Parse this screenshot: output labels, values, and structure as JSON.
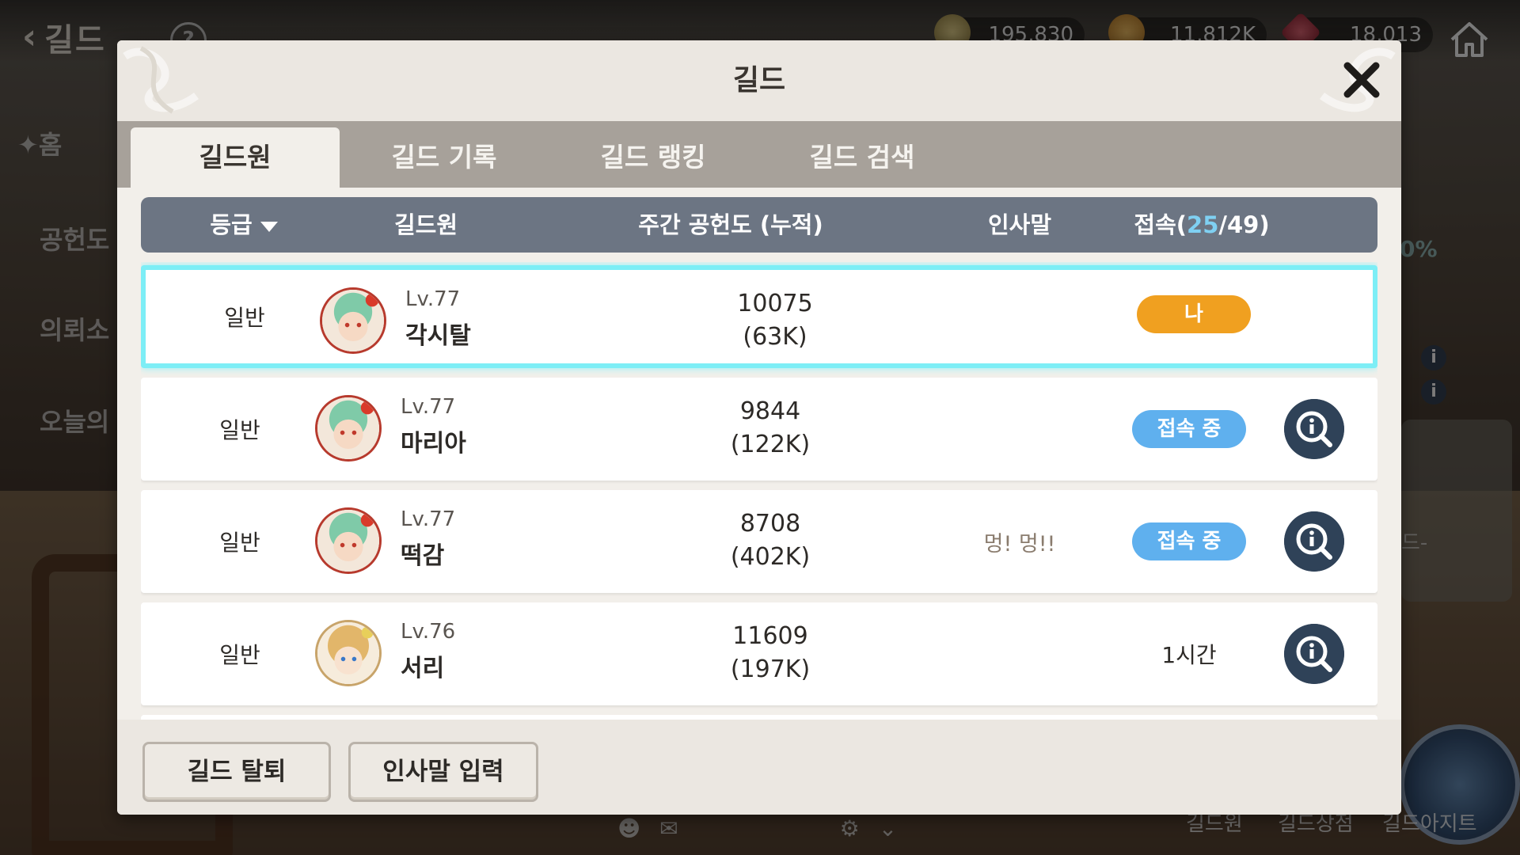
{
  "hud": {
    "back_title": "길드",
    "currencies": [
      {
        "value": "195,830",
        "icon": "gem-icon"
      },
      {
        "value": "11,812K",
        "icon": "gold-coin-icon"
      },
      {
        "value": "18,013",
        "icon": "crystal-icon"
      }
    ],
    "side_menu": [
      "홈",
      "공헌도",
      "의뢰소",
      "오늘의"
    ],
    "bottom_nav": [
      "길드원",
      "길드상점",
      "길드아지트"
    ],
    "side_percent": "0%",
    "side_label": "드-"
  },
  "modal": {
    "title": "길드",
    "tabs": [
      {
        "label": "길드원",
        "active": true
      },
      {
        "label": "길드 기록",
        "active": false
      },
      {
        "label": "길드 랭킹",
        "active": false
      },
      {
        "label": "길드 검색",
        "active": false
      }
    ],
    "columns": {
      "grade": "등급",
      "member": "길드원",
      "weekly_contribution": "주간 공헌도 (누적)",
      "greeting": "인사말",
      "online_label": "접속",
      "online_count": "25",
      "online_total": "/49"
    },
    "members": [
      {
        "grade": "일반",
        "level": "Lv.77",
        "name": "각시탈",
        "weekly": "10075",
        "total": "(63K)",
        "greeting": "",
        "status": "나",
        "status_type": "self",
        "portrait": "green-hair"
      },
      {
        "grade": "일반",
        "level": "Lv.77",
        "name": "마리아",
        "weekly": "9844",
        "total": "(122K)",
        "greeting": "",
        "status": "접속 중",
        "status_type": "online",
        "portrait": "green-hair"
      },
      {
        "grade": "일반",
        "level": "Lv.77",
        "name": "떡감",
        "weekly": "8708",
        "total": "(402K)",
        "greeting": "멍! 멍!!",
        "status": "접속 중",
        "status_type": "online",
        "portrait": "green-hair"
      },
      {
        "grade": "일반",
        "level": "Lv.76",
        "name": "서리",
        "weekly": "11609",
        "total": "(197K)",
        "greeting": "",
        "status": "1시간",
        "status_type": "offline",
        "portrait": "blonde-hair"
      }
    ],
    "footer": {
      "leave_button": "길드 탈퇴",
      "greeting_button": "인사말 입력"
    }
  },
  "colors": {
    "self_highlight": "#7deef6",
    "self_pill": "#f0a020",
    "online_pill": "#5fb0ee",
    "header_bar": "#6c7583",
    "tab_bar": "#a7a19a"
  }
}
